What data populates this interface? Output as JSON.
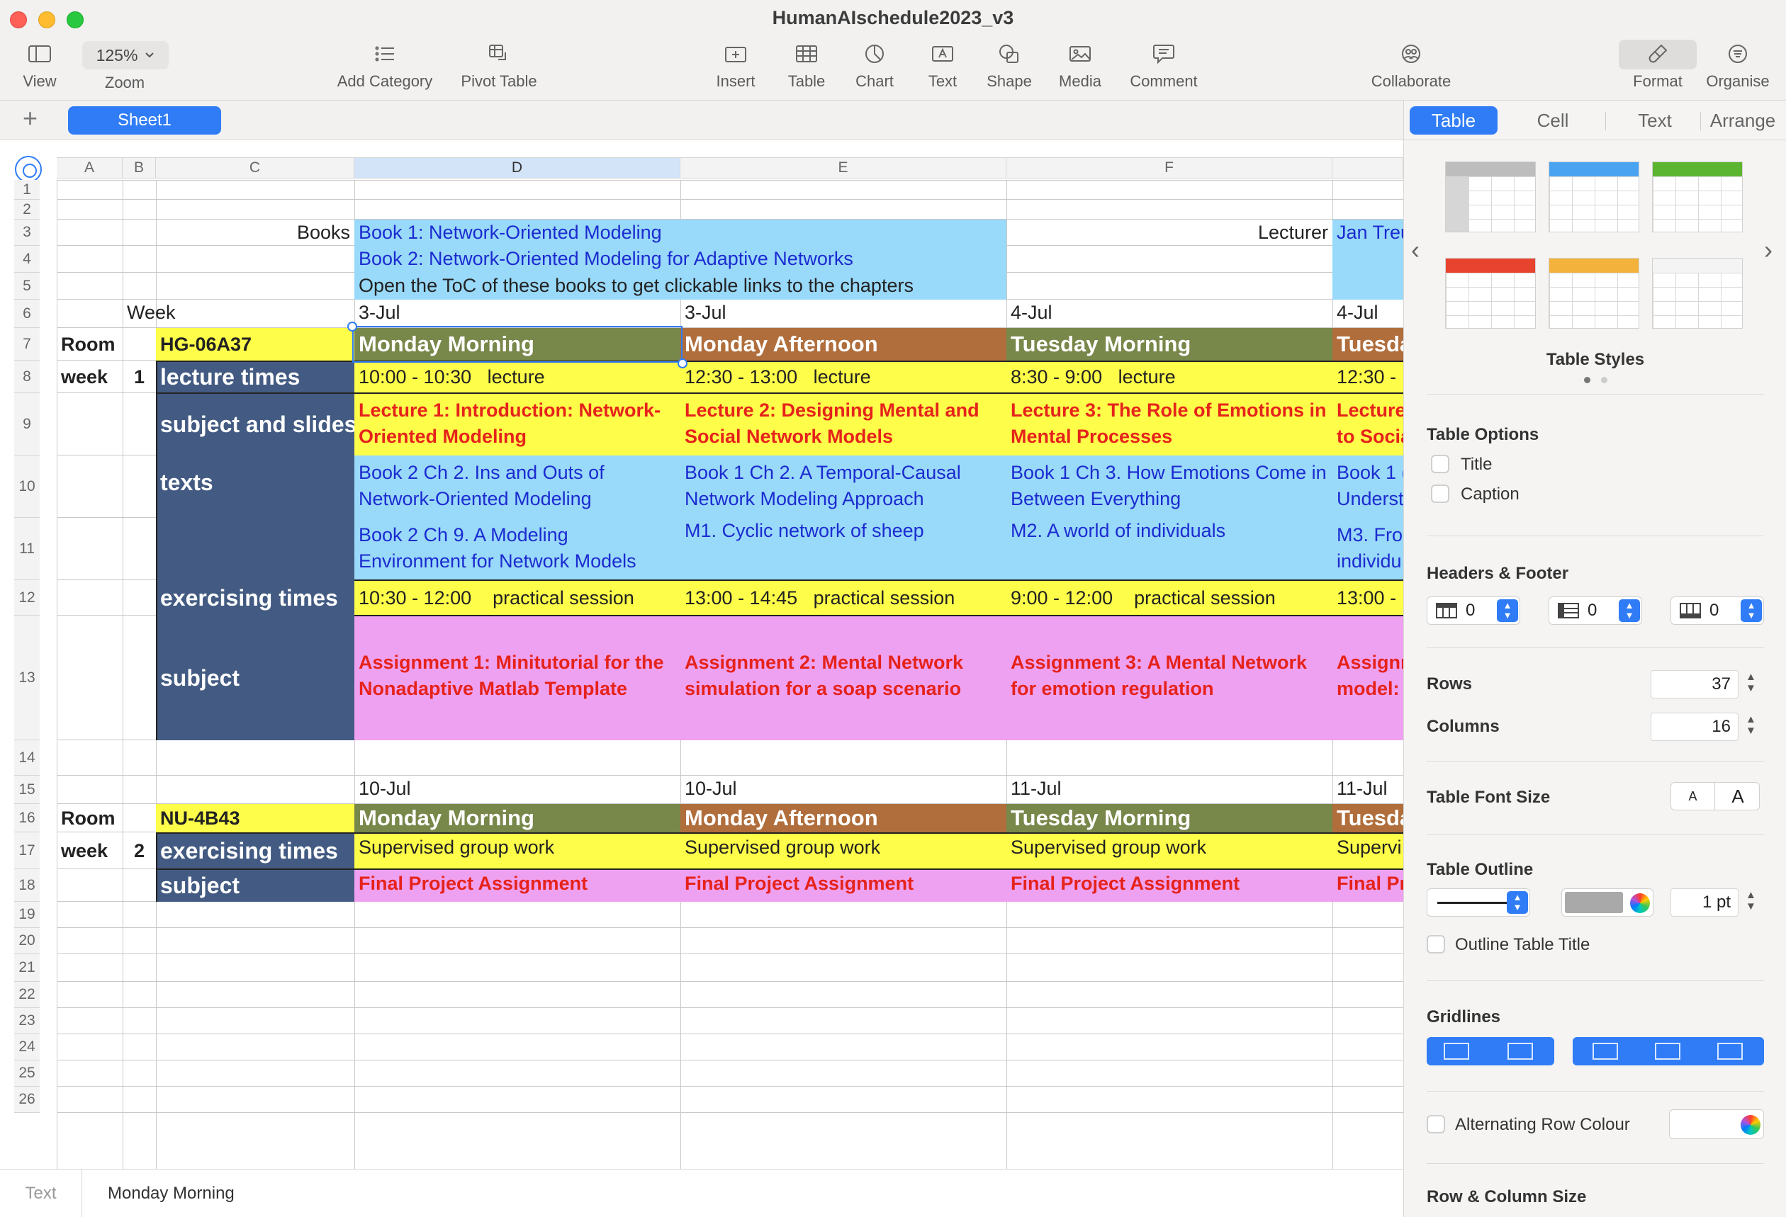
{
  "window": {
    "title": "HumanAIschedule2023_v3"
  },
  "toolbar": {
    "view_label": "View",
    "zoom_value": "125%",
    "zoom_label": "Zoom",
    "add_category_label": "Add Category",
    "pivot_table_label": "Pivot Table",
    "insert_label": "Insert",
    "table_label": "Table",
    "chart_label": "Chart",
    "text_label": "Text",
    "shape_label": "Shape",
    "media_label": "Media",
    "comment_label": "Comment",
    "collaborate_label": "Collaborate",
    "format_label": "Format",
    "organise_label": "Organise"
  },
  "sheets": {
    "add_label": "+",
    "active_sheet": "Sheet1"
  },
  "grid": {
    "columns": [
      "A",
      "B",
      "C",
      "D",
      "E",
      "F"
    ],
    "rows": [
      "1",
      "2",
      "3",
      "4",
      "5",
      "6",
      "7",
      "8",
      "9",
      "10",
      "11",
      "12",
      "13",
      "14",
      "15",
      "16",
      "17",
      "18",
      "19",
      "20",
      "21",
      "22",
      "23",
      "24",
      "25",
      "26"
    ]
  },
  "schedule": {
    "books_label": "Books",
    "book1": "Book 1: Network-Oriented Modeling",
    "book2": "Book 2: Network-Oriented Modeling for Adaptive Networks",
    "toc_note": "Open the ToC of these books to get clickable links to the chapters",
    "lecturer_label": "Lecturer",
    "lecturer_name": "Jan Treu",
    "week_header": "Week",
    "week1": {
      "room_label": "Room",
      "room": "HG-06A37",
      "week_label": "week",
      "week_number": "1",
      "lecture_times_label": "lecture times",
      "subject_slides_label": "subject and slides",
      "texts_label": "texts",
      "exercising_label": "exercising times",
      "subject_label": "subject",
      "dates": [
        "3-Jul",
        "3-Jul",
        "4-Jul",
        "4-Jul"
      ],
      "sessions": [
        "Monday Morning",
        "Monday Afternoon",
        "Tuesday Morning",
        "Tuesda"
      ],
      "lecture_times": [
        {
          "time": "10:00 - 10:30",
          "kind": "lecture"
        },
        {
          "time": "12:30 - 13:00",
          "kind": "lecture"
        },
        {
          "time": "8:30 - 9:00",
          "kind": "lecture"
        },
        {
          "time": "12:30 -",
          "kind": ""
        }
      ],
      "lectures": [
        "Lecture 1: Introduction: Network-Oriented Modeling",
        "Lecture 2: Designing Mental and Social Network Models",
        "Lecture 3: The Role of Emotions in Mental Processes",
        "Lecture\nto Socia"
      ],
      "texts_a": [
        "Book 2 Ch 2.  Ins and Outs of Network-Oriented Modeling",
        "Book 1 Ch 2.  A Temporal-Causal Network Modeling Approach",
        "Book 1 Ch 3.  How Emotions Come in Between Everything",
        "Book 1 (\nUnderst"
      ],
      "texts_b": [
        "Book 2 Ch 9.  A Modeling Environment for Network Models",
        "M1. Cyclic network of sheep",
        "M2. A world of individuals",
        "M3. Fro\nindividu"
      ],
      "exercise_times": [
        {
          "time": "10:30 - 12:00",
          "kind": "practical session"
        },
        {
          "time": "13:00 - 14:45",
          "kind": "practical session"
        },
        {
          "time": "9:00 - 12:00",
          "kind": "practical session"
        },
        {
          "time": "13:00 -",
          "kind": ""
        }
      ],
      "assignments": [
        "Assignment 1: Minitutorial for the Nonadaptive Matlab Template",
        "Assignment 2: Mental Network simulation for a soap scenario",
        "Assignment 3: A Mental Network for emotion regulation",
        "Assignm\nmodel:"
      ]
    },
    "week2": {
      "room_label": "Room",
      "room": "NU-4B43",
      "week_label": "week",
      "week_number": "2",
      "exercising_label": "exercising times",
      "subject_label": "subject",
      "dates": [
        "10-Jul",
        "10-Jul",
        "11-Jul",
        "11-Jul"
      ],
      "sessions": [
        "Monday Morning",
        "Monday Afternoon",
        "Tuesday Morning",
        "Tuesda"
      ],
      "exercise": [
        "Supervised group work",
        "Supervised group work",
        "Supervised group work",
        "Supervi"
      ],
      "subjects": [
        "Final Project Assignment",
        "Final Project Assignment",
        "Final Project Assignment",
        "Final Pr"
      ]
    }
  },
  "status": {
    "kind": "Text",
    "value": "Monday Morning"
  },
  "inspector": {
    "tabs": [
      "Table",
      "Cell",
      "Text",
      "Arrange"
    ],
    "table_styles_label": "Table Styles",
    "table_options_label": "Table Options",
    "title_option": "Title",
    "caption_option": "Caption",
    "headers_footer_label": "Headers & Footer",
    "header_rows_value": "0",
    "header_cols_value": "0",
    "footer_rows_value": "0",
    "rows_label": "Rows",
    "rows_value": "37",
    "columns_label": "Columns",
    "columns_value": "16",
    "font_size_label": "Table Font Size",
    "font_small": "A",
    "font_large": "A",
    "outline_label": "Table Outline",
    "outline_width": "1 pt",
    "outline_title_label": "Outline Table Title",
    "gridlines_label": "Gridlines",
    "alternating_label": "Alternating Row Colour",
    "row_col_size_label": "Row & Column Size",
    "colors": {
      "accent": "#2f7cf6",
      "light_blue": "#99d9f9",
      "yellow": "#fefe4a",
      "pink": "#efa1f1",
      "navy": "#435b82",
      "green": "#78874a",
      "brown": "#b06e3c"
    }
  }
}
